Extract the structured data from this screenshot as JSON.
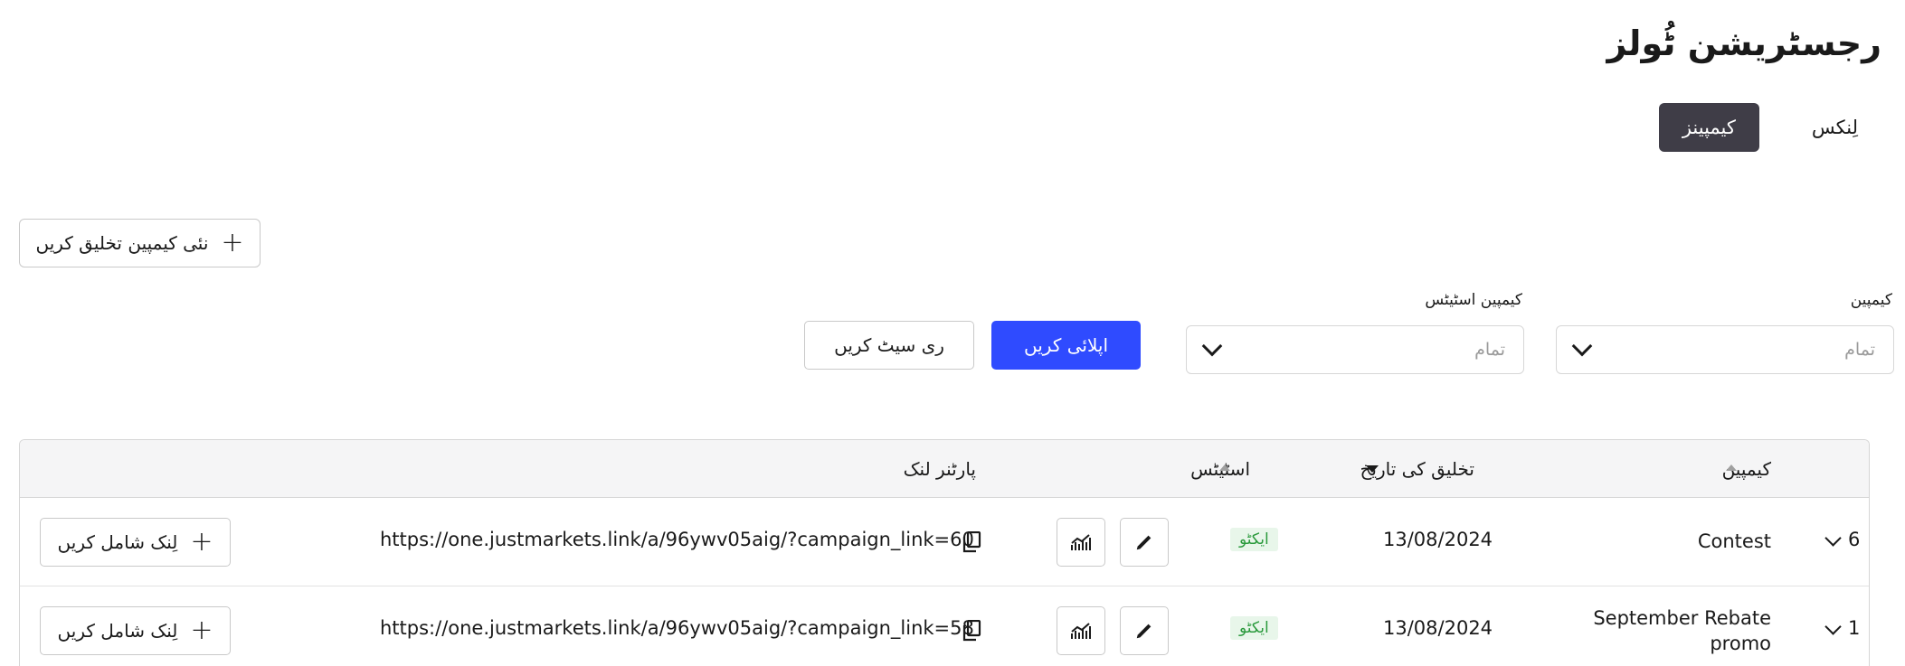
{
  "page": {
    "title": "رجسٹریشن ٹُولز"
  },
  "tabs": [
    {
      "label": "لِنکس",
      "active": false
    },
    {
      "label": "کیمپینز",
      "active": true
    }
  ],
  "toolbar": {
    "create_label": "نئی کیمپین تخلیق کریں"
  },
  "filters": {
    "campaign": {
      "label": "کیمپین",
      "placeholder": "تمام"
    },
    "status": {
      "label": "کیمپین اسٹیٹس",
      "placeholder": "تمام"
    },
    "apply_label": "اپلائی کریں",
    "reset_label": "ری سیٹ کریں"
  },
  "table": {
    "headers": {
      "campaign": "کیمپین",
      "created": "تخلیق کی تاریخ",
      "status": "اسٹیٹس",
      "partner_link": "پارٹنر لنک"
    },
    "add_link_label": "لِنک شامل کریں",
    "rows": [
      {
        "id": "6",
        "name": "Contest",
        "date": "13/08/2024",
        "status": "ایکٹو",
        "link": "https://one.justmarkets.link/a/96ywv05aig/?campaign_link=60"
      },
      {
        "id": "1",
        "name": "September Rebate promo",
        "date": "13/08/2024",
        "status": "ایکٹو",
        "link": "https://one.justmarkets.link/a/96ywv05aig/?campaign_link=58"
      }
    ]
  },
  "colors": {
    "accent": "#2f4bff",
    "active_tab": "#3f3d47",
    "status_active_bg": "#e8f6ea",
    "status_active_fg": "#2a9a3c"
  }
}
